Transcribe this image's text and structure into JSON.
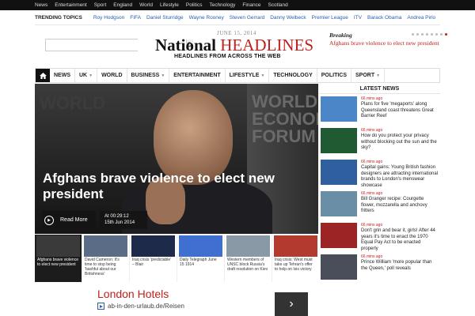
{
  "topbar": {
    "items": [
      "News",
      "Entertainment",
      "Sport",
      "England",
      "World",
      "Lifestyle",
      "Politics",
      "Technology",
      "Finance",
      "Scotland"
    ]
  },
  "trending": {
    "label": "TRENDING TOPICS",
    "topics": [
      "Roy Hodgson",
      "FIFA",
      "Daniel Sturridge",
      "Wayne Rooney",
      "Steven Gerrard",
      "Danny Welbeck",
      "Premier League",
      "ITV",
      "Barack Obama",
      "Andrea Pirlo"
    ]
  },
  "search": {
    "placeholder": ""
  },
  "logo": {
    "date": "JUNE 15, 2014",
    "word1": "National",
    "word2": "HEADLINES",
    "tagline": "HEADLINES FROM ACROSS THE WEB"
  },
  "breaking": {
    "label": "Breaking",
    "text": "Afghans brave violence to elect new president",
    "dots": 8,
    "active_dot": 7
  },
  "nav": {
    "items": [
      {
        "label": "NEWS",
        "caret": false
      },
      {
        "label": "UK",
        "caret": true
      },
      {
        "label": "WORLD",
        "caret": false
      },
      {
        "label": "BUSINESS",
        "caret": true
      },
      {
        "label": "ENTERTAINMENT",
        "caret": false
      },
      {
        "label": "LIFESTYLE",
        "caret": true
      },
      {
        "label": "TECHNOLOGY",
        "caret": false
      },
      {
        "label": "POLITICS",
        "caret": false
      },
      {
        "label": "SPORT",
        "caret": true
      }
    ]
  },
  "hero": {
    "title": "Afghans brave violence to elect new president",
    "read_more": "Read More",
    "time": "At 00:29:12",
    "date": "15th Jun 2014",
    "bg_text_left": "WORLD",
    "bg_text_right": "WORLD ECONOMIC FORUM"
  },
  "thumbs": [
    {
      "caption": "Afghans brave violence to elect new president",
      "color": "#3a3a3a"
    },
    {
      "caption": "David Cameron: It's time to stop being 'bashful about our Britishness'",
      "color": "#5b6c86"
    },
    {
      "caption": "Iraq crisis 'predictable' – Blair",
      "color": "#1e2a4a"
    },
    {
      "caption": "Daily Telegraph June 15 1914",
      "color": "#3f6fd1"
    },
    {
      "caption": "Western members of UNSC block Russia's draft resolution on Kiev",
      "color": "#8a99a6"
    },
    {
      "caption": "Iraq crisis: West must take up Tehran's offer to help on Isis victory",
      "color": "#b23a2f"
    }
  ],
  "latest": {
    "title": "LATEST NEWS",
    "items": [
      {
        "ago": "66 mins ago",
        "text": "Plans for five 'megaports' along Queensland coast threatens Great Barrier Reef",
        "color": "#4a86c8"
      },
      {
        "ago": "66 mins ago",
        "text": "How do you protect your privacy without blocking out the sun and the sky?",
        "color": "#1f5a32"
      },
      {
        "ago": "66 mins ago",
        "text": "Capital gains: Young British fashion designers are attracting international brands to London's menswear showcase",
        "color": "#2f5f9e"
      },
      {
        "ago": "66 mins ago",
        "text": "Bill Granger recipe: Courgette flower, mozzarella and anchovy fritters",
        "color": "#6b8ea7"
      },
      {
        "ago": "66 mins ago",
        "text": "Don't grin and bear it, girls! After 44 years it's time to enact the 1970 Equal Pay Act to be enacted properly",
        "color": "#9c2424"
      },
      {
        "ago": "66 mins ago",
        "text": "Prince William 'more popular than the Queen,' poll reveals",
        "color": "#4a4e5a"
      }
    ]
  },
  "ad": {
    "title": "London Hotels",
    "url": "ab-in-den-urlaub.de/Reisen",
    "button": "›"
  },
  "colors": {
    "accent": "#c0201d",
    "link": "#2a5db0",
    "topbar": "#111111"
  }
}
